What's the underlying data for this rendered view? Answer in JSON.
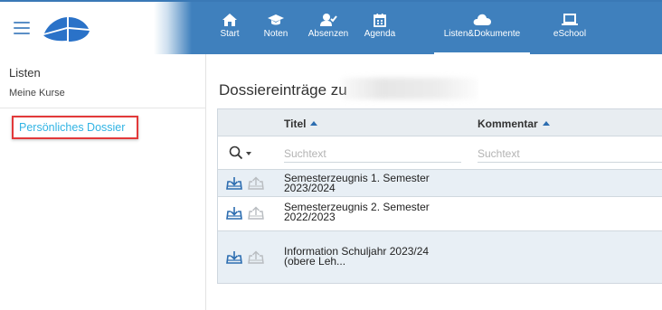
{
  "nav": {
    "items": [
      {
        "label": "Start",
        "icon": "home-icon"
      },
      {
        "label": "Noten",
        "icon": "graduation-cap-icon"
      },
      {
        "label": "Absenzen",
        "icon": "user-check-icon"
      },
      {
        "label": "Agenda",
        "icon": "calendar-icon"
      },
      {
        "label": "Listen&Dokumente",
        "icon": "cloud-icon",
        "active": true
      },
      {
        "label": "eSchool",
        "icon": "laptop-icon"
      }
    ]
  },
  "sidebar": {
    "listen": "Listen",
    "meine_kurse": "Meine Kurse",
    "dossier": "Persönliches Dossier"
  },
  "main": {
    "title": "Dossiereinträge zu ",
    "columns": {
      "titel": "Titel",
      "kommentar": "Kommentar"
    },
    "filter": {
      "titel_placeholder": "Suchtext",
      "kommentar_placeholder": "Suchtext"
    },
    "rows": [
      {
        "line1": "Semesterzeugnis 1. Semester",
        "line2": "2023/2024",
        "kommentar": ""
      },
      {
        "line1": "Semesterzeugnis 2. Semester",
        "line2": "2022/2023",
        "kommentar": ""
      },
      {
        "line1": "Information Schuljahr 2023/24",
        "line2": "(obere Leh...",
        "kommentar": ""
      }
    ]
  },
  "colors": {
    "topbar": "#3f80bd",
    "accent_link": "#31b4e4",
    "highlight_border": "#e2393a",
    "row_alt": "#e8eff5"
  }
}
